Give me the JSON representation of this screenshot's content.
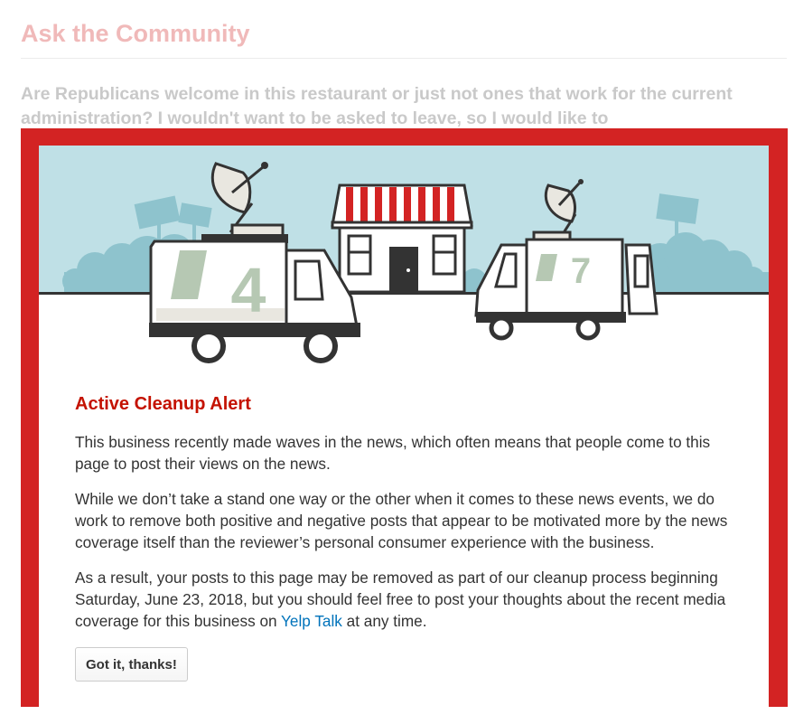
{
  "background": {
    "title": "Ask the Community",
    "question": "Are Republicans welcome in this restaurant or just not ones that work for the current administration? I wouldn't want to be asked to leave, so I would like to"
  },
  "modal": {
    "illustration": {
      "van_left_number": "4",
      "van_right_number": "7"
    },
    "title": "Active Cleanup Alert",
    "paragraph_1": "This business recently made waves in the news, which often means that people come to this page to post their views on the news.",
    "paragraph_2": "While we don’t take a stand one way or the other when it comes to these news events, we do work to remove both positive and negative posts that appear to be motivated more by the news coverage itself than the reviewer’s personal consumer experience with the business.",
    "paragraph_3_before": "As a result, your posts to this page may be removed as part of our cleanup process beginning Saturday, June 23, 2018, but you should feel free to post your thoughts about the recent media coverage for this business on ",
    "paragraph_3_link": "Yelp Talk",
    "paragraph_3_after": " at any time.",
    "button_label": "Got it, thanks!"
  },
  "colors": {
    "frame_red": "#d32323",
    "title_red": "#c41200",
    "link_blue": "#0073bb",
    "sky_blue": "#bfe0e6",
    "crowd_blue": "#8ec3cd"
  }
}
